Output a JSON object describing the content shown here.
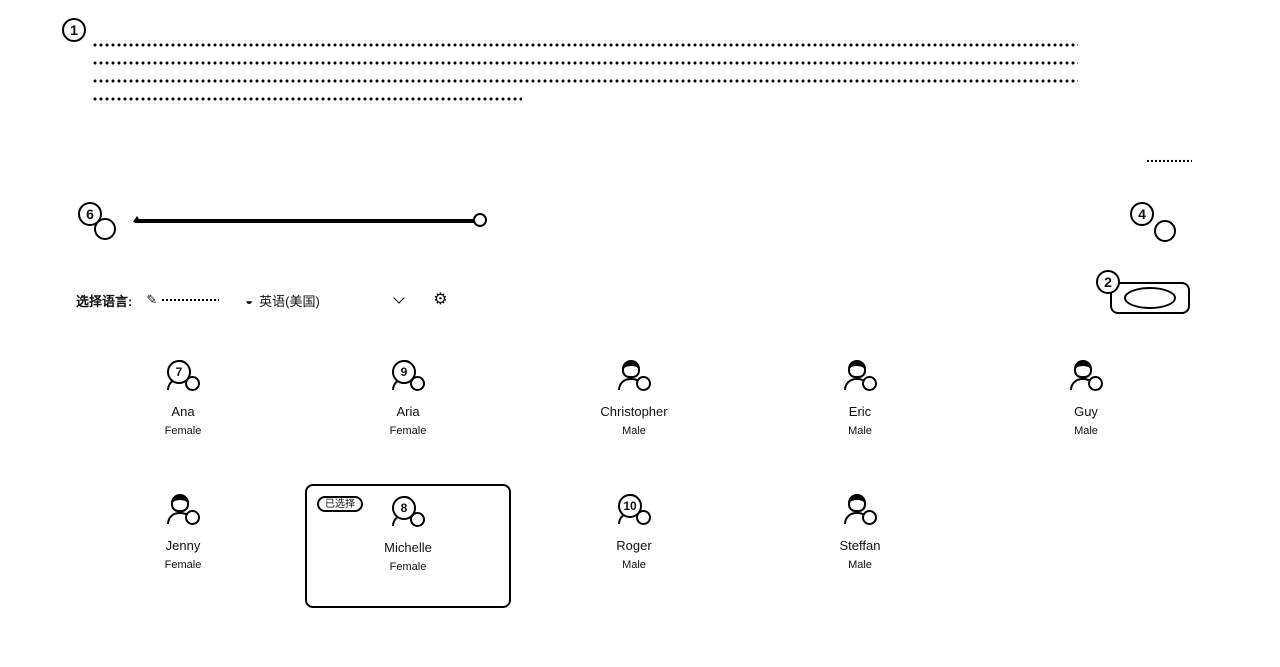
{
  "markers": {
    "m1": "1",
    "m2": "2",
    "m4": "4",
    "m6": "6"
  },
  "slider": {
    "value_fraction": 1.0
  },
  "language": {
    "label": "选择语言:",
    "selected": "英语(美国)"
  },
  "voices": [
    {
      "name": "Ana",
      "gender": "Female",
      "badge": "7"
    },
    {
      "name": "Aria",
      "gender": "Female",
      "badge": "9"
    },
    {
      "name": "Christopher",
      "gender": "Male"
    },
    {
      "name": "Eric",
      "gender": "Male"
    },
    {
      "name": "Guy",
      "gender": "Male"
    },
    {
      "name": "Jenny",
      "gender": "Female"
    },
    {
      "name": "Michelle",
      "gender": "Female",
      "badge": "8",
      "selected": true
    },
    {
      "name": "Roger",
      "gender": "Male",
      "badge": "10"
    },
    {
      "name": "Steffan",
      "gender": "Male"
    }
  ],
  "icons": {
    "settings": "gear-icon",
    "dropdown": "chevron-down-icon",
    "voice_avatar": "person-icon"
  }
}
